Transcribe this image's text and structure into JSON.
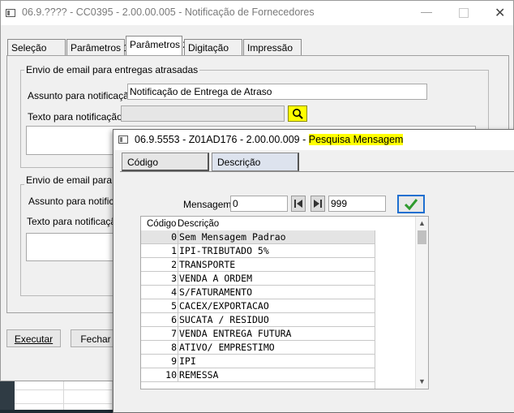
{
  "main_window": {
    "title": "06.9.???? - CC0395 - 2.00.00.005 - Notificação de Fornecedores",
    "tabs": [
      "Seleção",
      "Parâmetros 1",
      "Parâmetros 2",
      "Digitação",
      "Impressão"
    ],
    "active_tab": "Parâmetros 2",
    "group1": {
      "legend": "Envio de email para entregas atrasadas",
      "subject_label": "Assunto para notificação:",
      "subject_value": "Notificação de Entrega de Atraso",
      "text_label": "Texto para notificação:",
      "text_value": ""
    },
    "group2": {
      "legend": "Envio de email para en",
      "subject_label": "Assunto para notificaç",
      "text_label": "Texto para notificação"
    },
    "buttons": {
      "execute": "Executar",
      "close": "Fechar"
    }
  },
  "dialog": {
    "title_prefix": "06.9.5553 - Z01AD176 - 2.00.00.009 - ",
    "title_highlight": "Pesquisa Mensagem",
    "tabs": [
      "Código",
      "Descrição"
    ],
    "active_tab": "Código",
    "mensagem_label": "Mensagem:",
    "range_from": "0",
    "range_to": "999",
    "list_headers": {
      "code": "Código",
      "desc": "Descrição"
    },
    "rows": [
      {
        "code": "0",
        "desc": "Sem Mensagem Padrao"
      },
      {
        "code": "1",
        "desc": "IPI-TRIBUTADO 5%"
      },
      {
        "code": "2",
        "desc": "TRANSPORTE"
      },
      {
        "code": "3",
        "desc": "VENDA A ORDEM"
      },
      {
        "code": "4",
        "desc": "S/FATURAMENTO"
      },
      {
        "code": "5",
        "desc": "CACEX/EXPORTACAO"
      },
      {
        "code": "6",
        "desc": "SUCATA / RESIDUO"
      },
      {
        "code": "7",
        "desc": "VENDA ENTREGA FUTURA"
      },
      {
        "code": "8",
        "desc": "ATIVO/ EMPRESTIMO"
      },
      {
        "code": "9",
        "desc": "IPI"
      },
      {
        "code": "10",
        "desc": "REMESSA"
      }
    ]
  },
  "colors": {
    "highlight": "#ffff00",
    "confirm_green": "#2e9a2e",
    "confirm_border": "#1e6fd0"
  },
  "icons": {
    "search": "magnifier-icon",
    "confirm": "checkmark-icon",
    "first": "first-record-icon",
    "last": "last-record-icon"
  }
}
